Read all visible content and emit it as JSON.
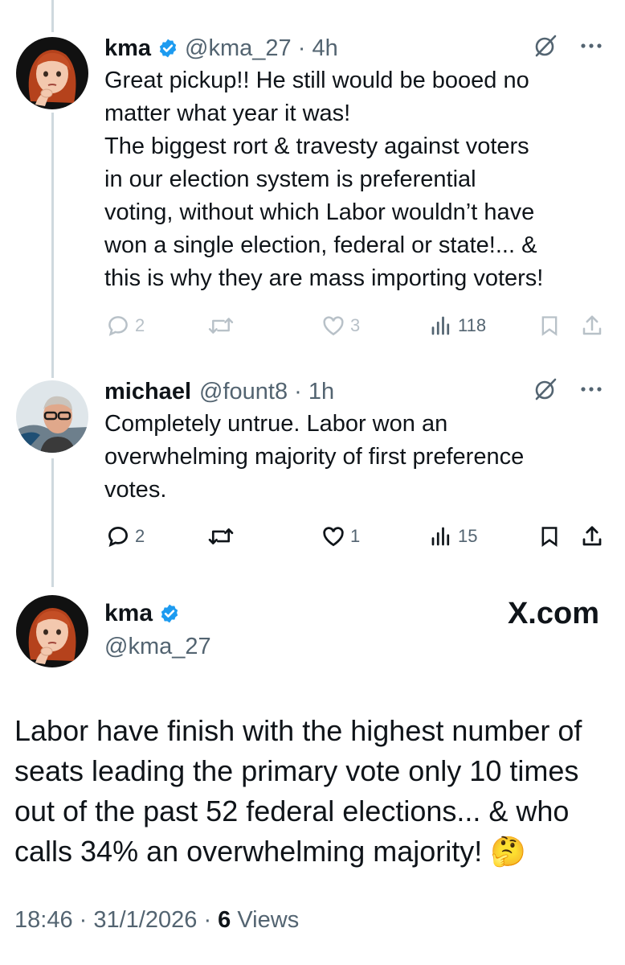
{
  "tweets": [
    {
      "name": "kma",
      "handle": "@kma_27",
      "time": "4h",
      "text_lines": [
        "Great pickup!!  He still would be booed no",
        "matter what year it was!",
        "The biggest rort & travesty against voters",
        "in our election system is preferential",
        "voting, without which Labor wouldn’t have",
        "won a single election, federal or state!... &",
        "this is why they are mass importing voters!"
      ],
      "replies": "2",
      "reposts": "",
      "likes": "3",
      "views": "118"
    },
    {
      "name": "michael",
      "handle": "@fount8",
      "time": "1h",
      "text_lines": [
        "Completely untrue. Labor won an",
        "overwhelming majority of first preference",
        "votes."
      ],
      "replies": "2",
      "reposts": "",
      "likes": "1",
      "views": "15"
    }
  ],
  "main": {
    "name": "kma",
    "handle": "@kma_27",
    "brand": "X.com",
    "text_lines": [
      "Labor have finish with the highest number of",
      "seats leading the primary vote only 10 times",
      "out of the past 52 federal elections... & who",
      "calls 34% an overwhelming majority! 🤔"
    ],
    "time": "18:46",
    "date": "31/1/2026",
    "views_count": "6",
    "views_label": "Views"
  },
  "colors": {
    "verified": "#1d9bf0",
    "text": "#0f1419",
    "muted": "#536471",
    "thread_line": "#cfd9de"
  },
  "icons": [
    "verified-badge-icon",
    "grok-icon",
    "more-icon",
    "reply-icon",
    "repost-icon",
    "like-icon",
    "views-icon",
    "bookmark-icon",
    "share-icon"
  ]
}
